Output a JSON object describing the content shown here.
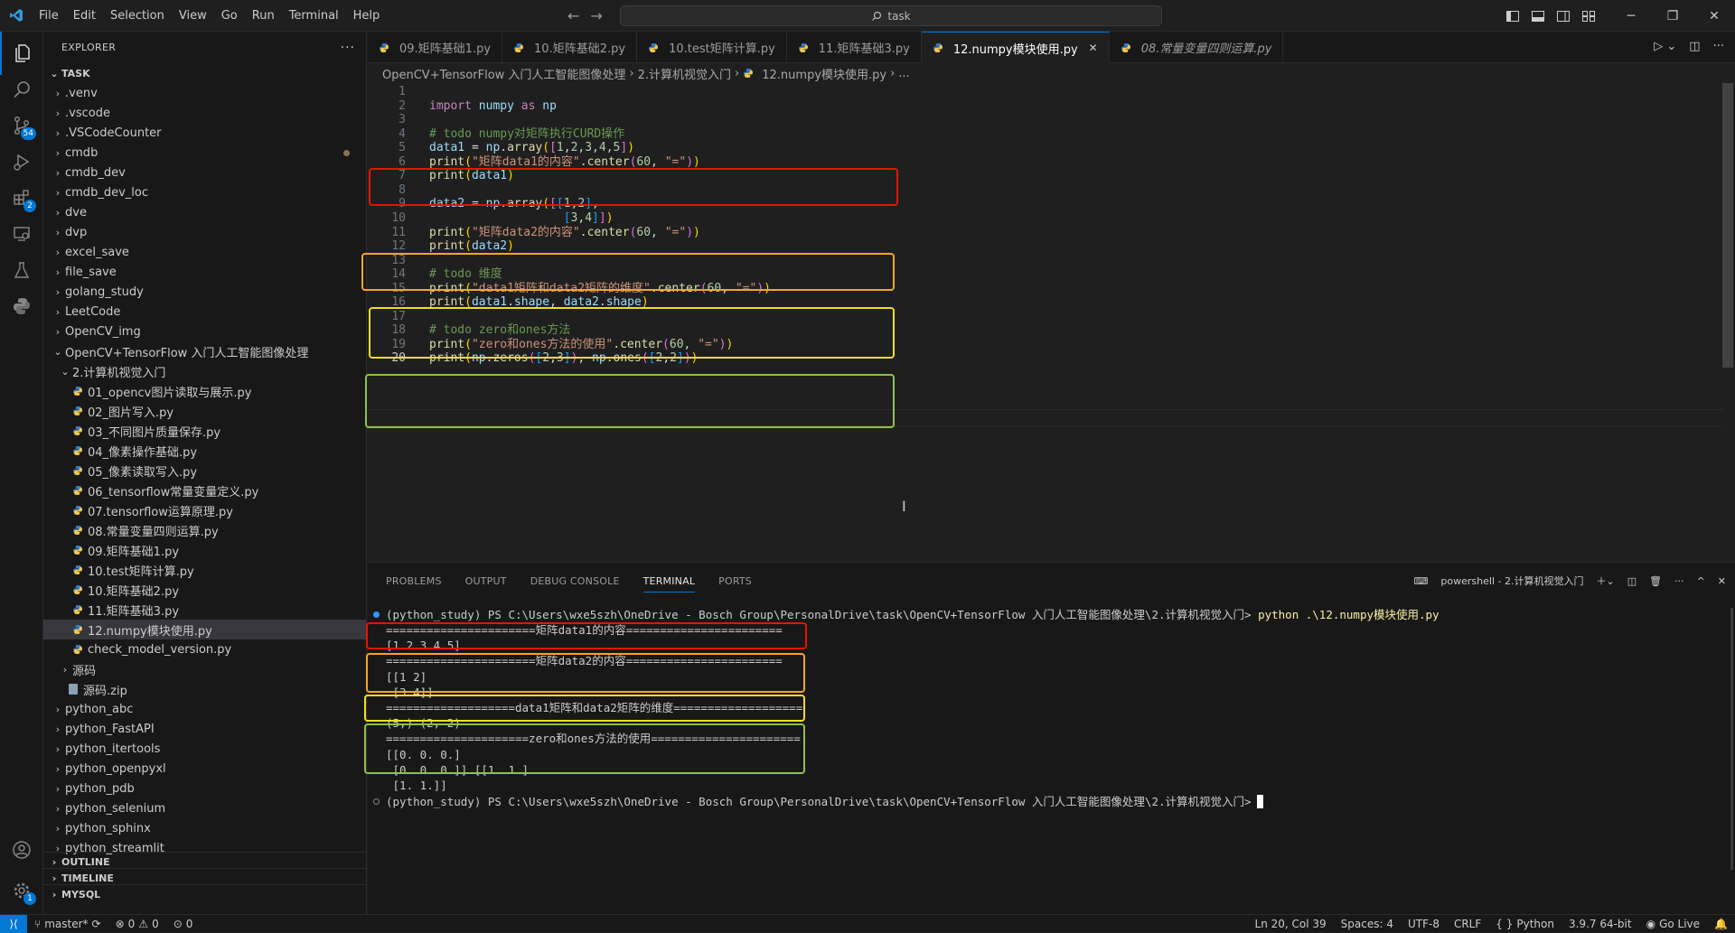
{
  "titlebar": {
    "menu": [
      "File",
      "Edit",
      "Selection",
      "View",
      "Go",
      "Run",
      "Terminal",
      "Help"
    ],
    "search": "task"
  },
  "activity": {
    "scm_badge": "54",
    "ext_badge": "2",
    "settings_badge": "1"
  },
  "sidebar": {
    "header": "EXPLORER",
    "root": "TASK",
    "items": [
      {
        "label": ".venv",
        "type": "folder",
        "depth": 0
      },
      {
        "label": ".vscode",
        "type": "folder",
        "depth": 0
      },
      {
        "label": ".VSCodeCounter",
        "type": "folder",
        "depth": 0
      },
      {
        "label": "cmdb",
        "type": "folder",
        "depth": 0,
        "modified": true
      },
      {
        "label": "cmdb_dev",
        "type": "folder",
        "depth": 0
      },
      {
        "label": "cmdb_dev_loc",
        "type": "folder",
        "depth": 0
      },
      {
        "label": "dve",
        "type": "folder",
        "depth": 0
      },
      {
        "label": "dvp",
        "type": "folder",
        "depth": 0
      },
      {
        "label": "excel_save",
        "type": "folder",
        "depth": 0
      },
      {
        "label": "file_save",
        "type": "folder",
        "depth": 0
      },
      {
        "label": "golang_study",
        "type": "folder",
        "depth": 0
      },
      {
        "label": "LeetCode",
        "type": "folder",
        "depth": 0
      },
      {
        "label": "OpenCV_img",
        "type": "folder",
        "depth": 0
      },
      {
        "label": "OpenCV+TensorFlow 入门人工智能图像处理",
        "type": "folder-open",
        "depth": 0
      },
      {
        "label": "2.计算机视觉入门",
        "type": "folder-open",
        "depth": 1
      },
      {
        "label": "01_opencv图片读取与展示.py",
        "type": "py",
        "depth": 2
      },
      {
        "label": "02_图片写入.py",
        "type": "py",
        "depth": 2
      },
      {
        "label": "03_不同图片质量保存.py",
        "type": "py",
        "depth": 2
      },
      {
        "label": "04_像素操作基础.py",
        "type": "py",
        "depth": 2
      },
      {
        "label": "05_像素读取写入.py",
        "type": "py",
        "depth": 2
      },
      {
        "label": "06_tensorflow常量变量定义.py",
        "type": "py",
        "depth": 2
      },
      {
        "label": "07.tensorflow运算原理.py",
        "type": "py",
        "depth": 2
      },
      {
        "label": "08.常量变量四则运算.py",
        "type": "py",
        "depth": 2
      },
      {
        "label": "09.矩阵基础1.py",
        "type": "py",
        "depth": 2
      },
      {
        "label": "10.test矩阵计算.py",
        "type": "py",
        "depth": 2
      },
      {
        "label": "10.矩阵基础2.py",
        "type": "py",
        "depth": 2
      },
      {
        "label": "11.矩阵基础3.py",
        "type": "py",
        "depth": 2
      },
      {
        "label": "12.numpy模块使用.py",
        "type": "py",
        "depth": 2,
        "active": true
      },
      {
        "label": "check_model_version.py",
        "type": "py",
        "depth": 2
      },
      {
        "label": "源码",
        "type": "folder",
        "depth": 1
      },
      {
        "label": "源码.zip",
        "type": "zip",
        "depth": 1
      },
      {
        "label": "python_abc",
        "type": "folder",
        "depth": 0
      },
      {
        "label": "python_FastAPI",
        "type": "folder",
        "depth": 0
      },
      {
        "label": "python_itertools",
        "type": "folder",
        "depth": 0
      },
      {
        "label": "python_openpyxl",
        "type": "folder",
        "depth": 0
      },
      {
        "label": "python_pdb",
        "type": "folder",
        "depth": 0
      },
      {
        "label": "python_selenium",
        "type": "folder",
        "depth": 0
      },
      {
        "label": "python_sphinx",
        "type": "folder",
        "depth": 0
      },
      {
        "label": "python_streamlit",
        "type": "folder",
        "depth": 0
      }
    ],
    "sections": [
      "OUTLINE",
      "TIMELINE",
      "MYSQL"
    ]
  },
  "tabs": [
    {
      "label": "09.矩阵基础1.py"
    },
    {
      "label": "10.矩阵基础2.py"
    },
    {
      "label": "10.test矩阵计算.py"
    },
    {
      "label": "11.矩阵基础3.py"
    },
    {
      "label": "12.numpy模块使用.py",
      "active": true
    },
    {
      "label": "08.常量变量四则运算.py",
      "italic": true
    }
  ],
  "breadcrumb": [
    "OpenCV+TensorFlow 入门人工智能图像处理",
    "2.计算机视觉入门",
    "12.numpy模块使用.py",
    "..."
  ],
  "code": {
    "line_numbers": [
      "1",
      "2",
      "3",
      "4",
      "5",
      "6",
      "7",
      "8",
      "9",
      "10",
      "11",
      "12",
      "13",
      "14",
      "15",
      "16",
      "17",
      "18",
      "19",
      "20"
    ],
    "lines": [
      [],
      [
        [
          "kw",
          "import"
        ],
        [
          "tx",
          " "
        ],
        [
          "id",
          "numpy"
        ],
        [
          "tx",
          " "
        ],
        [
          "kw",
          "as"
        ],
        [
          "tx",
          " "
        ],
        [
          "id",
          "np"
        ]
      ],
      [],
      [
        [
          "cm",
          "# todo numpy对矩阵执行CURD操作"
        ]
      ],
      [
        [
          "id",
          "data1"
        ],
        [
          "tx",
          " = "
        ],
        [
          "id",
          "np"
        ],
        [
          "tx",
          "."
        ],
        [
          "fn",
          "array"
        ],
        [
          "br",
          "("
        ],
        [
          "br2",
          "["
        ],
        [
          "num",
          "1"
        ],
        [
          "tx",
          ","
        ],
        [
          "num",
          "2"
        ],
        [
          "tx",
          ","
        ],
        [
          "num",
          "3"
        ],
        [
          "tx",
          ","
        ],
        [
          "num",
          "4"
        ],
        [
          "tx",
          ","
        ],
        [
          "num",
          "5"
        ],
        [
          "br2",
          "]"
        ],
        [
          "br",
          ")"
        ]
      ],
      [
        [
          "fn",
          "print"
        ],
        [
          "br",
          "("
        ],
        [
          "str",
          "\"矩阵data1的内容\""
        ],
        [
          "tx",
          "."
        ],
        [
          "fn",
          "center"
        ],
        [
          "br2",
          "("
        ],
        [
          "num",
          "60"
        ],
        [
          "tx",
          ", "
        ],
        [
          "str",
          "\"=\""
        ],
        [
          "br2",
          ")"
        ],
        [
          "br",
          ")"
        ]
      ],
      [
        [
          "fn",
          "print"
        ],
        [
          "br",
          "("
        ],
        [
          "id",
          "data1"
        ],
        [
          "br",
          ")"
        ]
      ],
      [],
      [
        [
          "id",
          "data2"
        ],
        [
          "tx",
          " = "
        ],
        [
          "id",
          "np"
        ],
        [
          "tx",
          "."
        ],
        [
          "fn",
          "array"
        ],
        [
          "br",
          "("
        ],
        [
          "br2",
          "["
        ],
        [
          "br3",
          "["
        ],
        [
          "num",
          "1"
        ],
        [
          "tx",
          ","
        ],
        [
          "num",
          "2"
        ],
        [
          "br3",
          "]"
        ],
        [
          "tx",
          ","
        ]
      ],
      [
        [
          "tx",
          "                   "
        ],
        [
          "br3",
          "["
        ],
        [
          "num",
          "3"
        ],
        [
          "tx",
          ","
        ],
        [
          "num",
          "4"
        ],
        [
          "br3",
          "]"
        ],
        [
          "br2",
          "]"
        ],
        [
          "br",
          ")"
        ]
      ],
      [
        [
          "fn",
          "print"
        ],
        [
          "br",
          "("
        ],
        [
          "str",
          "\"矩阵data2的内容\""
        ],
        [
          "tx",
          "."
        ],
        [
          "fn",
          "center"
        ],
        [
          "br2",
          "("
        ],
        [
          "num",
          "60"
        ],
        [
          "tx",
          ", "
        ],
        [
          "str",
          "\"=\""
        ],
        [
          "br2",
          ")"
        ],
        [
          "br",
          ")"
        ]
      ],
      [
        [
          "fn",
          "print"
        ],
        [
          "br",
          "("
        ],
        [
          "id",
          "data2"
        ],
        [
          "br",
          ")"
        ]
      ],
      [],
      [
        [
          "cm",
          "# todo 维度"
        ]
      ],
      [
        [
          "fn",
          "print"
        ],
        [
          "br",
          "("
        ],
        [
          "str",
          "\"data1矩阵和data2矩阵的维度\""
        ],
        [
          "tx",
          "."
        ],
        [
          "fn",
          "center"
        ],
        [
          "br2",
          "("
        ],
        [
          "num",
          "60"
        ],
        [
          "tx",
          ", "
        ],
        [
          "str",
          "\"=\""
        ],
        [
          "br2",
          ")"
        ],
        [
          "br",
          ")"
        ]
      ],
      [
        [
          "fn",
          "print"
        ],
        [
          "br",
          "("
        ],
        [
          "id",
          "data1"
        ],
        [
          "tx",
          "."
        ],
        [
          "id",
          "shape"
        ],
        [
          "tx",
          ", "
        ],
        [
          "id",
          "data2"
        ],
        [
          "tx",
          "."
        ],
        [
          "id",
          "shape"
        ],
        [
          "br",
          ")"
        ]
      ],
      [],
      [
        [
          "cm",
          "# todo zero和ones方法"
        ]
      ],
      [
        [
          "fn",
          "print"
        ],
        [
          "br",
          "("
        ],
        [
          "str",
          "\"zero和ones方法的使用\""
        ],
        [
          "tx",
          "."
        ],
        [
          "fn",
          "center"
        ],
        [
          "br2",
          "("
        ],
        [
          "num",
          "60"
        ],
        [
          "tx",
          ", "
        ],
        [
          "str",
          "\"=\""
        ],
        [
          "br2",
          ")"
        ],
        [
          "br",
          ")"
        ]
      ],
      [
        [
          "fn",
          "print"
        ],
        [
          "br",
          "("
        ],
        [
          "id",
          "np"
        ],
        [
          "tx",
          "."
        ],
        [
          "fn",
          "zeros"
        ],
        [
          "br2",
          "("
        ],
        [
          "br3",
          "["
        ],
        [
          "num",
          "2"
        ],
        [
          "tx",
          ","
        ],
        [
          "num",
          "3"
        ],
        [
          "br3",
          "]"
        ],
        [
          "br2",
          ")"
        ],
        [
          "tx",
          ", "
        ],
        [
          "id",
          "np"
        ],
        [
          "tx",
          "."
        ],
        [
          "fn",
          "ones"
        ],
        [
          "br2",
          "("
        ],
        [
          "br3",
          "["
        ],
        [
          "num",
          "2"
        ],
        [
          "tx",
          ","
        ],
        [
          "num",
          "2"
        ],
        [
          "br3",
          "]"
        ],
        [
          "br2",
          ")"
        ],
        [
          "br",
          ")"
        ]
      ]
    ]
  },
  "colors": {
    "red": "#e51400",
    "orange": "#f5a623",
    "yellow": "#f0e020",
    "green": "#8bc34a",
    "accent": "#0078d4"
  },
  "panel": {
    "tabs": [
      "PROBLEMS",
      "OUTPUT",
      "DEBUG CONSOLE",
      "TERMINAL",
      "PORTS"
    ],
    "active_tab": "TERMINAL",
    "terminal_name": "powershell - 2.计算机视觉入门",
    "prompt": "(python_study) PS C:\\Users\\wxe5szh\\OneDrive - Bosch Group\\PersonalDrive\\task\\OpenCV+TensorFlow 入门人工智能图像处理\\2.计算机视觉入门>",
    "command": " python .\\12.numpy模块使用.py",
    "output": [
      "======================矩阵data1的内容=======================",
      "[1 2 3 4 5]",
      "======================矩阵data2的内容=======================",
      "[[1 2]",
      " [3 4]]",
      "===================data1矩阵和data2矩阵的维度===================",
      "(5,) (2, 2)",
      "=====================zero和ones方法的使用======================",
      "[[0. 0. 0.]",
      " [0. 0. 0.]] [[1. 1.]",
      " [1. 1.]]"
    ]
  },
  "status": {
    "branch": "master*",
    "errors": "0",
    "warnings": "0",
    "ports": "0",
    "position": "Ln 20, Col 39",
    "spaces": "Spaces: 4",
    "encoding": "UTF-8",
    "eol": "CRLF",
    "language": "Python",
    "interpreter": "3.9.7 64-bit",
    "golive": "Go Live"
  }
}
